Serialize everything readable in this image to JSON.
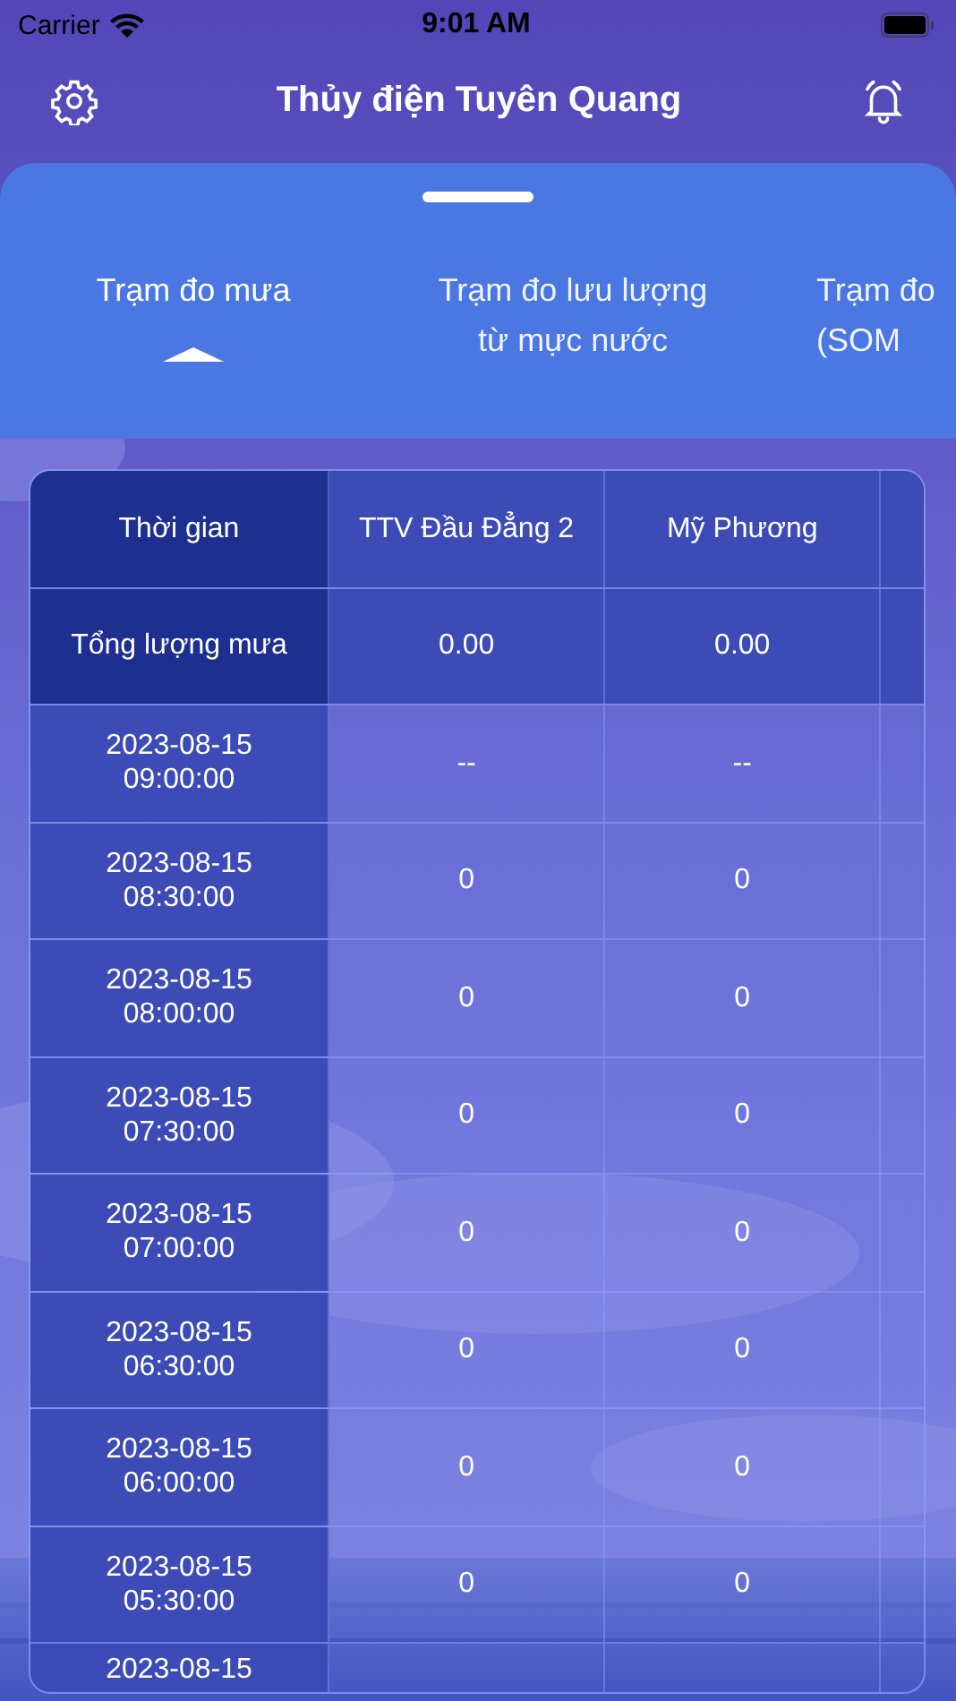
{
  "status_bar": {
    "carrier": "Carrier",
    "time": "9:01 AM"
  },
  "header": {
    "title": "Thủy điện Tuyên Quang"
  },
  "tabs": [
    {
      "lines": [
        "Trạm đo mưa"
      ],
      "selected": true
    },
    {
      "lines": [
        "Trạm đo lưu lượng",
        "từ mực nước"
      ],
      "selected": false
    },
    {
      "lines": [
        "Trạm đo",
        "(SOM"
      ],
      "selected": false
    }
  ],
  "table": {
    "columns": [
      "Thời gian",
      "TTV Đầu Đẳng 2",
      "Mỹ Phương"
    ],
    "total": {
      "label": "Tổng lượng mưa",
      "values": [
        "0.00",
        "0.00"
      ]
    },
    "rows": [
      {
        "time": [
          "2023-08-15",
          "09:00:00"
        ],
        "values": [
          "--",
          "--"
        ]
      },
      {
        "time": [
          "2023-08-15",
          "08:30:00"
        ],
        "values": [
          "0",
          "0"
        ]
      },
      {
        "time": [
          "2023-08-15",
          "08:00:00"
        ],
        "values": [
          "0",
          "0"
        ]
      },
      {
        "time": [
          "2023-08-15",
          "07:30:00"
        ],
        "values": [
          "0",
          "0"
        ]
      },
      {
        "time": [
          "2023-08-15",
          "07:00:00"
        ],
        "values": [
          "0",
          "0"
        ]
      },
      {
        "time": [
          "2023-08-15",
          "06:30:00"
        ],
        "values": [
          "0",
          "0"
        ]
      },
      {
        "time": [
          "2023-08-15",
          "06:00:00"
        ],
        "values": [
          "0",
          "0"
        ]
      },
      {
        "time": [
          "2023-08-15",
          "05:30:00"
        ],
        "values": [
          "0",
          "0"
        ]
      },
      {
        "time": [
          "2023-08-15"
        ],
        "values": []
      }
    ]
  }
}
